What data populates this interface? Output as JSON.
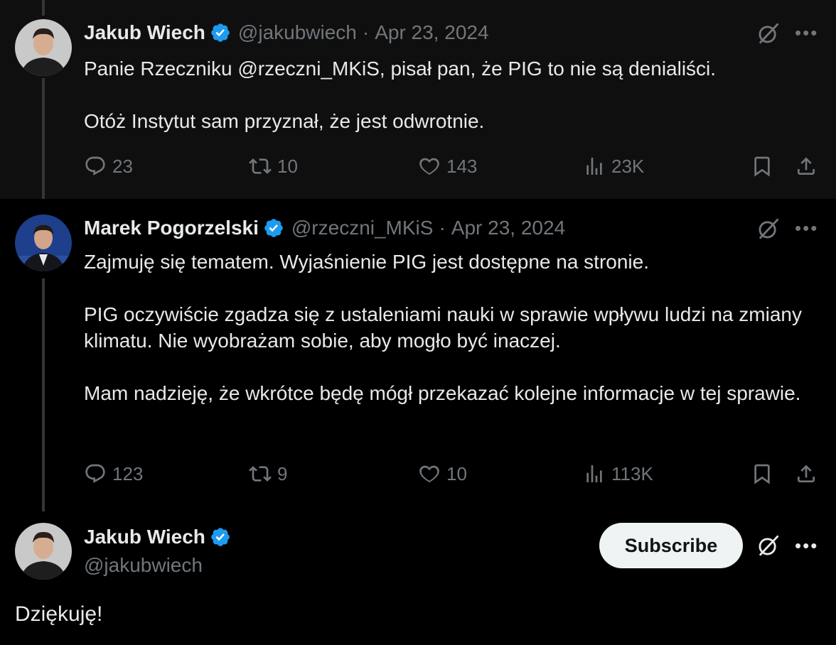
{
  "colors": {
    "background": "#000000",
    "highlight_background": "#0f0f0f",
    "text": "#e7e9ea",
    "secondary": "#71767b",
    "verified": "#1d9bf0",
    "subscribe_bg": "#eff3f4"
  },
  "tweets": [
    {
      "name": "Jakub Wiech",
      "handle": "@jakubwiech",
      "separator": "·",
      "date": "Apr 23, 2024",
      "text": "Panie Rzeczniku @rzeczni_MKiS, pisał pan, że PIG to nie są denialiści.\n\nOtóż Instytut sam przyznał, że jest odwrotnie.",
      "replies": "23",
      "retweets": "10",
      "likes": "143",
      "views": "23K"
    },
    {
      "name": "Marek Pogorzelski",
      "handle": "@rzeczni_MKiS",
      "separator": "·",
      "date": "Apr 23, 2024",
      "text": "Zajmuję się tematem. Wyjaśnienie PIG jest dostępne na stronie.\n\nPIG oczywiście zgadza się z ustaleniami nauki w sprawie wpływu ludzi na zmiany klimatu. Nie wyobrażam sobie, aby mogło być inaczej.\n\nMam nadzieję, że wkrótce będę mógł przekazać kolejne informacje w tej sprawie.",
      "replies": "123",
      "retweets": "9",
      "likes": "10",
      "views": "113K"
    },
    {
      "name": "Jakub Wiech",
      "handle": "@jakubwiech",
      "subscribe_label": "Subscribe",
      "text": "Dziękuję!"
    }
  ],
  "icons": {
    "reply": "reply-icon",
    "retweet": "retweet-icon",
    "like": "like-icon",
    "views": "views-icon",
    "bookmark": "bookmark-icon",
    "share": "share-icon",
    "grok": "grok-icon",
    "more": "more-icon",
    "verified": "verified-badge-icon"
  }
}
